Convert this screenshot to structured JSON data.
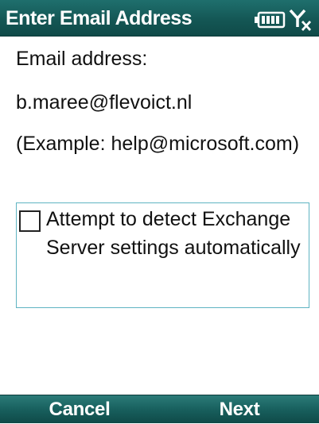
{
  "title_bar": {
    "title": "Enter Email Address",
    "status_icons": [
      "battery-icon",
      "signal-no-service-icon"
    ],
    "background_color": "#145755",
    "text_color": "#ffffff"
  },
  "form": {
    "email_label": "Email address:",
    "email_value": "b.maree@flevoict.nl",
    "example_text": "(Example: help@microsoft.com)"
  },
  "options": {
    "auto_detect": {
      "label_line1": "Attempt to detect Exchange",
      "label_line2": "Server settings automatically",
      "checked": false
    },
    "border_color": "#5fb4c2"
  },
  "softkeys": {
    "left": "Cancel",
    "right": "Next",
    "background_color": "#18605e"
  }
}
